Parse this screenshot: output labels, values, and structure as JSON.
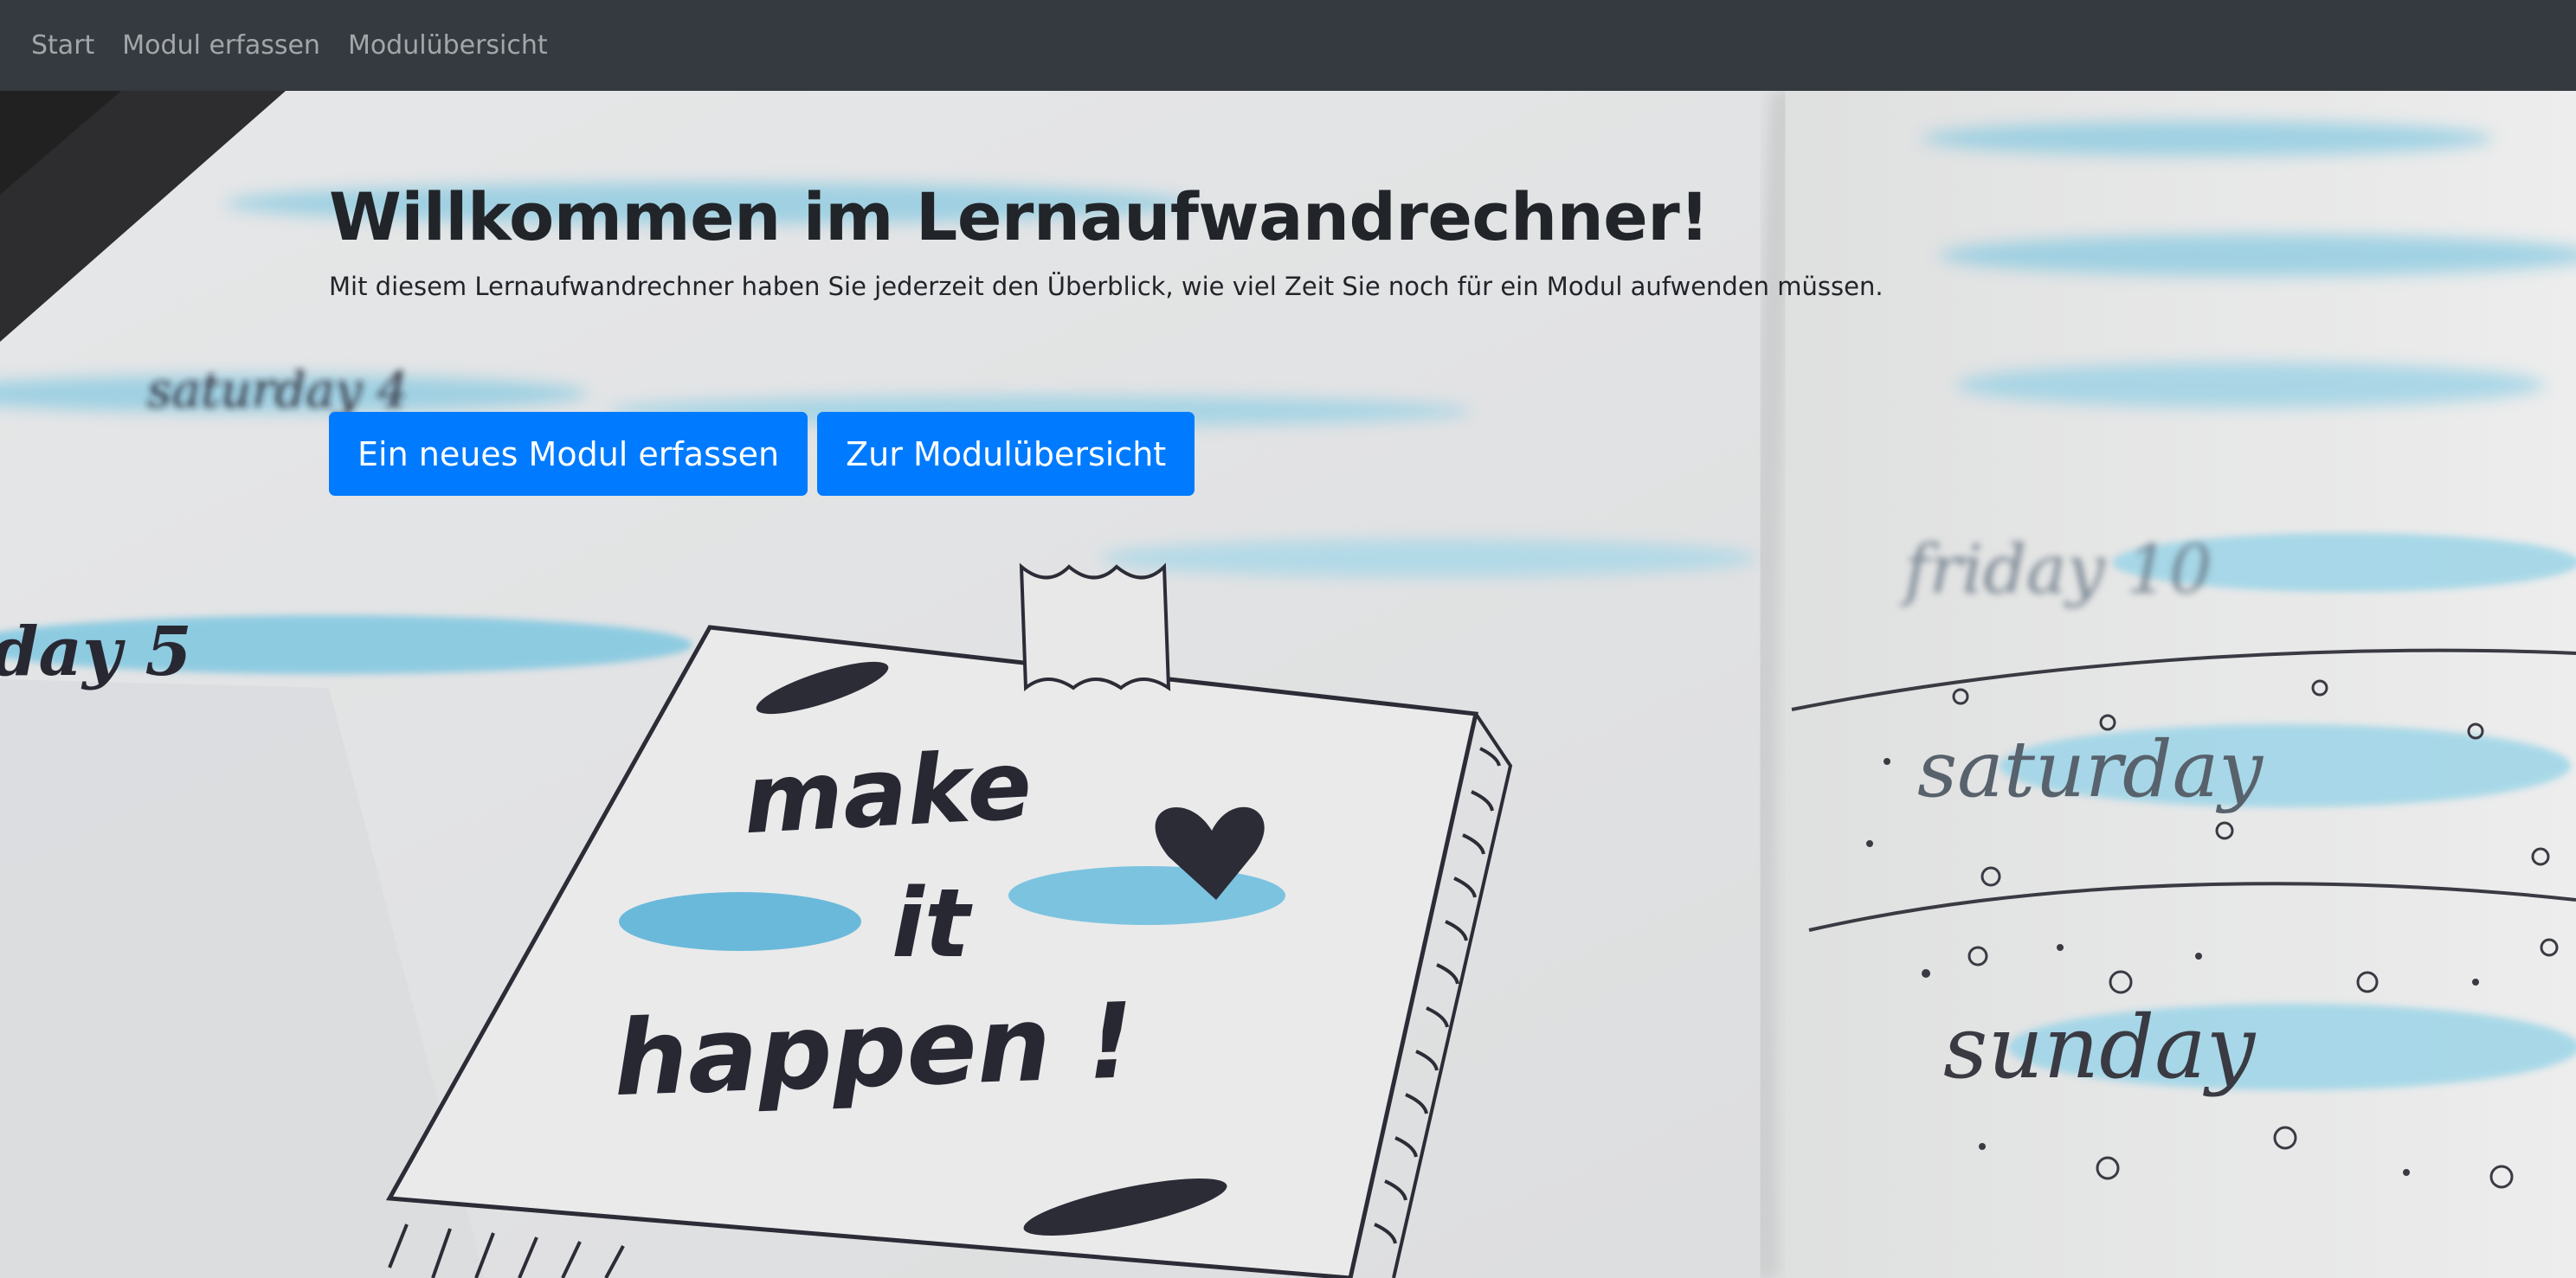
{
  "navbar": {
    "items": [
      {
        "label": "Start"
      },
      {
        "label": "Modul erfassen"
      },
      {
        "label": "Modulübersicht"
      }
    ]
  },
  "hero": {
    "title": "Willkommen im Lernaufwandrechner!",
    "lead": "Mit diesem Lernaufwandrechner haben Sie jederzeit den Überblick, wie viel Zeit Sie noch für ein Modul aufwenden müssen.",
    "primary_button": "Ein neues Modul erfassen",
    "secondary_button": "Zur Modulübersicht"
  },
  "background_image": {
    "handwriting": [
      "saturday 4",
      "day 5",
      "make",
      "it",
      "happen !",
      "friday 10",
      "saturday",
      "sunday"
    ]
  },
  "colors": {
    "navbar_bg": "#343a40",
    "nav_link": "rgba(255,255,255,0.55)",
    "button_primary": "#007bff",
    "text_dark": "#212529",
    "highlighter_blue": "#5bc0de"
  }
}
